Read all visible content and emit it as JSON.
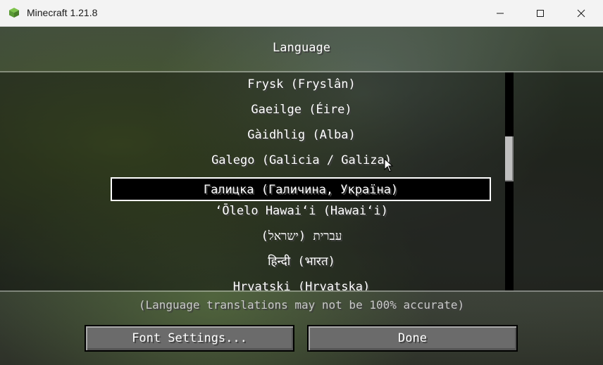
{
  "window": {
    "title": "Minecraft 1.21.8",
    "icons": {
      "app": "minecraft-grass-block-icon",
      "minimize": "minimize-icon",
      "maximize": "maximize-icon",
      "close": "close-icon"
    }
  },
  "screen": {
    "title": "Language"
  },
  "languages": [
    "Frysk (Fryslân)",
    "Gaeilge (Éire)",
    "Gàidhlig (Alba)",
    "Galego (Galicia / Galiza)",
    "Галицка (Галичина, Україна)",
    "ʻŌlelo Hawaiʻi (Hawaiʻi)",
    "עברית (ישראל)",
    "हिन्दी (भारत)",
    "Hrvatski (Hrvatska)"
  ],
  "selected_index": 4,
  "disclaimer": "(Language translations may not be 100% accurate)",
  "buttons": {
    "font_settings": "Font Settings...",
    "done": "Done"
  },
  "colors": {
    "text": "#ffffff",
    "selection_border": "#ffffff",
    "button_face": "#6b6b6b",
    "disclaimer_text": "#c8c8c8"
  }
}
